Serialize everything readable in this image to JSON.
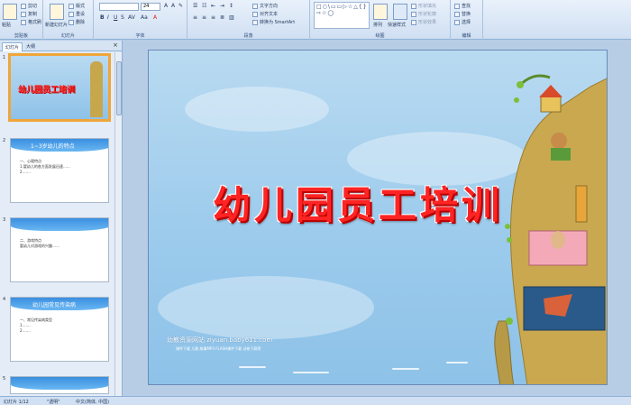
{
  "ribbon": {
    "clipboard": {
      "label": "剪贴板",
      "paste": "粘贴",
      "cut": "剪切",
      "copy": "复制",
      "format_painter": "格式刷"
    },
    "slides": {
      "label": "幻灯片",
      "new_slide": "新建幻灯片",
      "layout": "版式",
      "reset": "重设",
      "delete": "删除"
    },
    "font": {
      "label": "字体",
      "font_name": "",
      "font_size": "24"
    },
    "paragraph": {
      "label": "段落",
      "text_direction": "文字方向",
      "align_text": "对齐文本",
      "convert_smartart": "转换为 SmartArt"
    },
    "drawing": {
      "label": "绘图",
      "shapes_preview": "□○\\▭▭▷☆△{}⇨☆◯",
      "arrange": "排列",
      "quick_styles": "快速样式",
      "shape_fill": "形状填充",
      "shape_outline": "形状轮廓",
      "shape_effects": "形状效果"
    },
    "editing": {
      "label": "编辑",
      "find": "查找",
      "replace": "替换",
      "select": "选择"
    }
  },
  "panel": {
    "tabs": [
      "幻灯片",
      "大纲"
    ],
    "close": "×",
    "thumbnails": [
      {
        "num": "1",
        "title": "幼儿园员工培训",
        "lines": []
      },
      {
        "num": "2",
        "title": "1~3岁幼儿的特点",
        "lines": [
          "一、心理特点",
          "1.婴幼儿的各方面发展迅速……",
          "2.……"
        ]
      },
      {
        "num": "3",
        "title": "",
        "lines": [
          "二、游戏特点",
          "婴幼儿对游戏的兴趣……"
        ]
      },
      {
        "num": "4",
        "title": "幼儿园常见传染病",
        "lines": [
          "一、常见传染病类型",
          "1.……",
          "2.……"
        ]
      },
      {
        "num": "5",
        "title": "",
        "lines": []
      }
    ]
  },
  "slide": {
    "title": "幼儿园员工培训",
    "footer_site": "幼教资源网站  ziyuan.baby611.com",
    "footer_links": "课件下载   儿歌   故事MP3   FLASH课件下载   试卷下载等"
  },
  "status": {
    "slide_position": "幻灯片 1/12",
    "theme": "\"透明\"",
    "language": "中文(简体, 中国)"
  },
  "colors": {
    "title_red": "#ff2424",
    "slide_bg": "#9ccbec",
    "selection": "#f0a53a"
  }
}
